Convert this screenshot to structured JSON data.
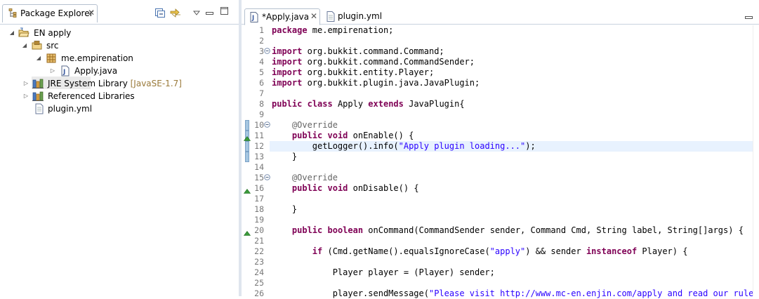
{
  "package_explorer": {
    "tab_label": "Package Explorer",
    "tree": [
      {
        "label": "EN apply",
        "decoration": "",
        "icon": "project-icon",
        "expanded": true
      },
      {
        "label": "src",
        "decoration": "",
        "icon": "source-folder-icon",
        "expanded": true
      },
      {
        "label": "me.empirenation",
        "decoration": "",
        "icon": "package-icon",
        "expanded": true
      },
      {
        "label": "Apply.java",
        "decoration": "",
        "icon": "java-file-icon",
        "expanded": false
      },
      {
        "label": "JRE System Library",
        "decoration": "[JavaSE-1.7]",
        "icon": "library-icon",
        "expanded": false
      },
      {
        "label": "Referenced Libraries",
        "decoration": "",
        "icon": "library-icon",
        "expanded": false
      },
      {
        "label": "plugin.yml",
        "decoration": "",
        "icon": "text-file-icon",
        "expanded": false
      }
    ]
  },
  "editor": {
    "tabs": [
      {
        "label": "*Apply.java",
        "active": true,
        "closable": true
      },
      {
        "label": "plugin.yml",
        "active": false,
        "closable": false
      }
    ],
    "lines": [
      {
        "n": "1",
        "t": [
          [
            "kw",
            "package"
          ],
          [
            "",
            " me.empirenation;"
          ]
        ]
      },
      {
        "n": "2",
        "t": []
      },
      {
        "n": "3",
        "t": [
          [
            "kw",
            "import"
          ],
          [
            "",
            " org.bukkit.command.Command;"
          ]
        ]
      },
      {
        "n": "4",
        "t": [
          [
            "kw",
            "import"
          ],
          [
            "",
            " org.bukkit.command.CommandSender;"
          ]
        ]
      },
      {
        "n": "5",
        "t": [
          [
            "kw",
            "import"
          ],
          [
            "",
            " org.bukkit.entity.Player;"
          ]
        ]
      },
      {
        "n": "6",
        "t": [
          [
            "kw",
            "import"
          ],
          [
            "",
            " org.bukkit.plugin.java.JavaPlugin;"
          ]
        ]
      },
      {
        "n": "7",
        "t": []
      },
      {
        "n": "8",
        "t": [
          [
            "kw",
            "public"
          ],
          [
            "",
            " "
          ],
          [
            "kw",
            "class"
          ],
          [
            "",
            " Apply "
          ],
          [
            "kw",
            "extends"
          ],
          [
            "",
            " JavaPlugin{"
          ]
        ]
      },
      {
        "n": "9",
        "t": []
      },
      {
        "n": "10",
        "t": [
          [
            "",
            "    "
          ],
          [
            "ann",
            "@Override"
          ]
        ]
      },
      {
        "n": "11",
        "t": [
          [
            "",
            "    "
          ],
          [
            "kw",
            "public"
          ],
          [
            "",
            " "
          ],
          [
            "kw",
            "void"
          ],
          [
            "",
            " onEnable() {"
          ]
        ]
      },
      {
        "n": "12",
        "t": [
          [
            "",
            "        getLogger().info("
          ],
          [
            "str",
            "\"Apply plugin loading...\""
          ],
          [
            "",
            ");"
          ]
        ]
      },
      {
        "n": "13",
        "t": [
          [
            "",
            "    }"
          ]
        ]
      },
      {
        "n": "14",
        "t": []
      },
      {
        "n": "15",
        "t": [
          [
            "",
            "    "
          ],
          [
            "ann",
            "@Override"
          ]
        ]
      },
      {
        "n": "16",
        "t": [
          [
            "",
            "    "
          ],
          [
            "kw",
            "public"
          ],
          [
            "",
            " "
          ],
          [
            "kw",
            "void"
          ],
          [
            "",
            " onDisable() {"
          ]
        ]
      },
      {
        "n": "17",
        "t": []
      },
      {
        "n": "18",
        "t": [
          [
            "",
            "    }"
          ]
        ]
      },
      {
        "n": "19",
        "t": []
      },
      {
        "n": "20",
        "t": [
          [
            "",
            "    "
          ],
          [
            "kw",
            "public"
          ],
          [
            "",
            " "
          ],
          [
            "kw",
            "boolean"
          ],
          [
            "",
            " onCommand(CommandSender sender, Command Cmd, String label, String[]args) {"
          ]
        ]
      },
      {
        "n": "21",
        "t": []
      },
      {
        "n": "22",
        "t": [
          [
            "",
            "        "
          ],
          [
            "kw",
            "if"
          ],
          [
            "",
            " (Cmd.getName().equalsIgnoreCase("
          ],
          [
            "str",
            "\"apply\""
          ],
          [
            "",
            ") && sender "
          ],
          [
            "kw",
            "instanceof"
          ],
          [
            "",
            " Player) {"
          ]
        ]
      },
      {
        "n": "23",
        "t": []
      },
      {
        "n": "24",
        "t": [
          [
            "",
            "            Player player = (Player) sender;"
          ]
        ]
      },
      {
        "n": "25",
        "t": []
      },
      {
        "n": "26",
        "t": [
          [
            "",
            "            player.sendMessage("
          ],
          [
            "str",
            "\"Please visit http://www.mc-en.enjin.com/apply and read our rules o"
          ]
        ]
      }
    ],
    "fold_lines": [
      "3",
      "10",
      "15"
    ],
    "override_markers": [
      "11",
      "16",
      "20"
    ],
    "current_line": "12"
  },
  "colors": {
    "keyword": "#7f0055",
    "annotation": "#646464",
    "string": "#2a00ff",
    "current_line_bg": "#e8f2fe"
  }
}
